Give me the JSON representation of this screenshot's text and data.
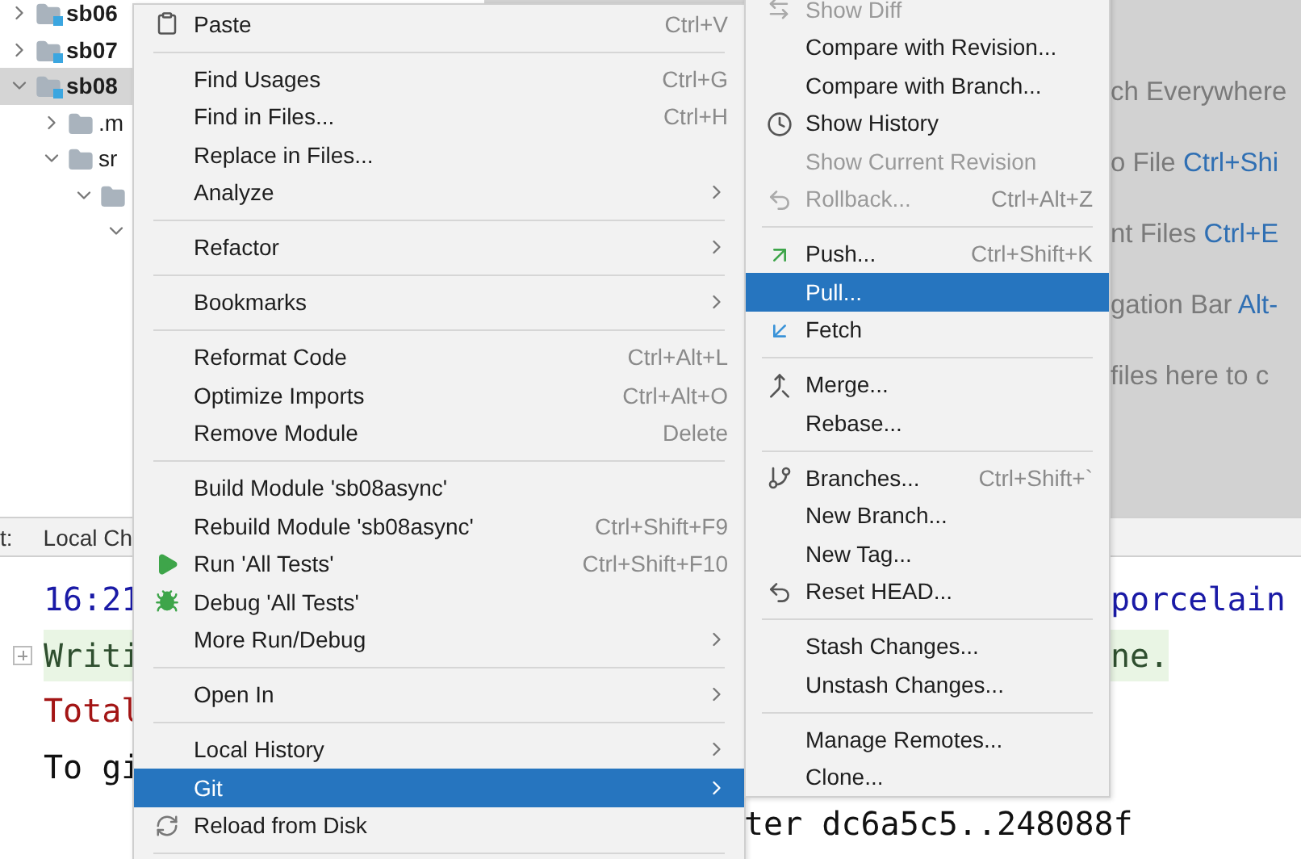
{
  "project_tree": [
    {
      "label": "sb06",
      "kind": "module",
      "expanded": false,
      "selected": false
    },
    {
      "label": "sb07",
      "kind": "module",
      "expanded": false,
      "selected": false
    },
    {
      "label": "sb08",
      "kind": "module",
      "expanded": true,
      "selected": true,
      "children": [
        {
          "label": ".m",
          "kind": "folder",
          "expanded": false,
          "selected": false
        },
        {
          "label": "sr",
          "kind": "folder",
          "expanded": true,
          "selected": false,
          "children": [
            {
              "kind": "folder",
              "expanded": true,
              "selected": false,
              "children": [
                {
                  "expanded": true,
                  "selected": false
                }
              ]
            }
          ]
        }
      ]
    }
  ],
  "editor_hints": [
    {
      "text": "ch Everywhere"
    },
    {
      "text": "o File ",
      "shortcut": "Ctrl+Shi"
    },
    {
      "text": "nt Files ",
      "shortcut": "Ctrl+E"
    },
    {
      "text": "gation Bar ",
      "shortcut": "Alt-"
    },
    {
      "text": "files here to c"
    }
  ],
  "bottom_panel": {
    "label": "t:",
    "tabs": [
      {
        "label": "Local Ch"
      }
    ]
  },
  "console": [
    {
      "kind": "time",
      "left": "16:21",
      "right": "porcelain",
      "foldable": false
    },
    {
      "kind": "highlight",
      "left": "Writi",
      "right": "ne.",
      "foldable": true
    },
    {
      "kind": "error",
      "left": "Total",
      "foldable": false
    },
    {
      "kind": "plain",
      "left": "To gi",
      "foldable": false
    },
    {
      "kind": "plain",
      "middle": "ter dc6a5c5..248088f",
      "foldable": false
    }
  ],
  "context_menu": [
    {
      "kind": "item",
      "label": "Paste",
      "shortcut": "Ctrl+V",
      "has_submenu": false,
      "selected": false
    },
    {
      "kind": "separator"
    },
    {
      "kind": "item",
      "label": "Find Usages",
      "shortcut": "Ctrl+G",
      "has_submenu": false,
      "selected": false
    },
    {
      "kind": "item",
      "label": "Find in Files...",
      "shortcut": "Ctrl+H",
      "has_submenu": false,
      "selected": false
    },
    {
      "kind": "item",
      "label": "Replace in Files...",
      "has_submenu": false,
      "selected": false
    },
    {
      "kind": "item",
      "label": "Analyze",
      "has_submenu": true,
      "selected": false
    },
    {
      "kind": "separator"
    },
    {
      "kind": "item",
      "label": "Refactor",
      "has_submenu": true,
      "selected": false
    },
    {
      "kind": "separator"
    },
    {
      "kind": "item",
      "label": "Bookmarks",
      "has_submenu": true,
      "selected": false
    },
    {
      "kind": "separator"
    },
    {
      "kind": "item",
      "label": "Reformat Code",
      "shortcut": "Ctrl+Alt+L",
      "has_submenu": false,
      "selected": false
    },
    {
      "kind": "item",
      "label": "Optimize Imports",
      "shortcut": "Ctrl+Alt+O",
      "has_submenu": false,
      "selected": false
    },
    {
      "kind": "item",
      "label": "Remove Module",
      "shortcut": "Delete",
      "has_submenu": false,
      "selected": false
    },
    {
      "kind": "separator"
    },
    {
      "kind": "item",
      "label": "Build Module 'sb08async'",
      "has_submenu": false,
      "selected": false
    },
    {
      "kind": "item",
      "label": "Rebuild Module 'sb08async'",
      "shortcut": "Ctrl+Shift+F9",
      "has_submenu": false,
      "selected": false
    },
    {
      "kind": "item",
      "label": "Run 'All Tests'",
      "shortcut": "Ctrl+Shift+F10",
      "has_submenu": false,
      "selected": false
    },
    {
      "kind": "item",
      "label": "Debug 'All Tests'",
      "has_submenu": false,
      "selected": false
    },
    {
      "kind": "item",
      "label": "More Run/Debug",
      "has_submenu": true,
      "selected": false
    },
    {
      "kind": "separator"
    },
    {
      "kind": "item",
      "label": "Open In",
      "has_submenu": true,
      "selected": false
    },
    {
      "kind": "separator"
    },
    {
      "kind": "item",
      "label": "Local History",
      "has_submenu": true,
      "selected": false
    },
    {
      "kind": "item",
      "label": "Git",
      "has_submenu": true,
      "selected": true
    },
    {
      "kind": "item",
      "label": "Reload from Disk",
      "has_submenu": false,
      "selected": false
    },
    {
      "kind": "separator"
    }
  ],
  "git_submenu": [
    {
      "kind": "item",
      "label": "Show Diff",
      "disabled": true,
      "selected": false
    },
    {
      "kind": "item",
      "label": "Compare with Revision...",
      "disabled": false,
      "selected": false
    },
    {
      "kind": "item",
      "label": "Compare with Branch...",
      "disabled": false,
      "selected": false
    },
    {
      "kind": "item",
      "label": "Show History",
      "disabled": false,
      "selected": false
    },
    {
      "kind": "item",
      "label": "Show Current Revision",
      "disabled": true,
      "selected": false
    },
    {
      "kind": "item",
      "label": "Rollback...",
      "shortcut": "Ctrl+Alt+Z",
      "disabled": true,
      "selected": false
    },
    {
      "kind": "separator"
    },
    {
      "kind": "item",
      "label": "Push...",
      "shortcut": "Ctrl+Shift+K",
      "disabled": false,
      "selected": false
    },
    {
      "kind": "item",
      "label": "Pull...",
      "disabled": false,
      "selected": true
    },
    {
      "kind": "item",
      "label": "Fetch",
      "disabled": false,
      "selected": false
    },
    {
      "kind": "separator"
    },
    {
      "kind": "item",
      "label": "Merge...",
      "disabled": false,
      "selected": false
    },
    {
      "kind": "item",
      "label": "Rebase...",
      "disabled": false,
      "selected": false
    },
    {
      "kind": "separator"
    },
    {
      "kind": "item",
      "label": "Branches...",
      "shortcut": "Ctrl+Shift+`",
      "disabled": false,
      "selected": false
    },
    {
      "kind": "item",
      "label": "New Branch...",
      "disabled": false,
      "selected": false
    },
    {
      "kind": "item",
      "label": "New Tag...",
      "disabled": false,
      "selected": false
    },
    {
      "kind": "item",
      "label": "Reset HEAD...",
      "disabled": false,
      "selected": false
    },
    {
      "kind": "separator"
    },
    {
      "kind": "item",
      "label": "Stash Changes...",
      "disabled": false,
      "selected": false
    },
    {
      "kind": "item",
      "label": "Unstash Changes...",
      "disabled": false,
      "selected": false
    },
    {
      "kind": "separator"
    },
    {
      "kind": "item",
      "label": "Manage Remotes...",
      "disabled": false,
      "selected": false
    },
    {
      "kind": "item",
      "label": "Clone...",
      "disabled": false,
      "selected": false
    }
  ]
}
